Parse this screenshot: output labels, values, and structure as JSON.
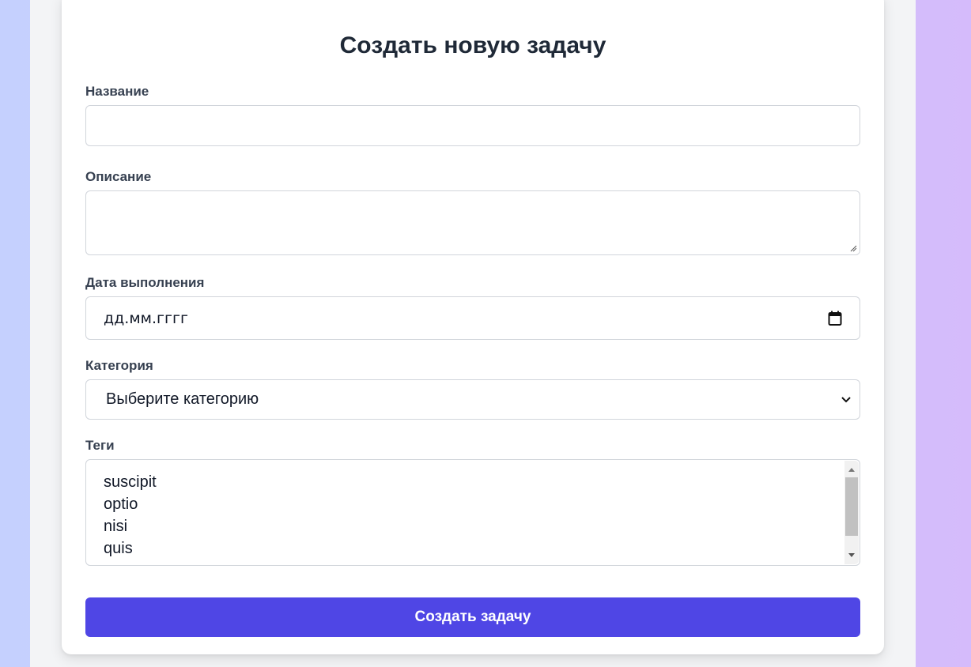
{
  "form": {
    "title": "Создать новую задачу",
    "fields": {
      "name": {
        "label": "Название",
        "value": ""
      },
      "description": {
        "label": "Описание",
        "value": ""
      },
      "due_date": {
        "label": "Дата выполнения",
        "placeholder": "дд.мм.гггг",
        "icon": "calendar-icon"
      },
      "category": {
        "label": "Категория",
        "selected": "Выберите категорию",
        "icon": "chevron-down-icon"
      },
      "tags": {
        "label": "Теги",
        "options": [
          "suscipit",
          "optio",
          "nisi",
          "quis"
        ]
      }
    },
    "submit_label": "Создать задачу"
  },
  "colors": {
    "accent": "#4f46e5",
    "background_left": "#c5d0fe",
    "background_right": "#d5bbfb"
  }
}
